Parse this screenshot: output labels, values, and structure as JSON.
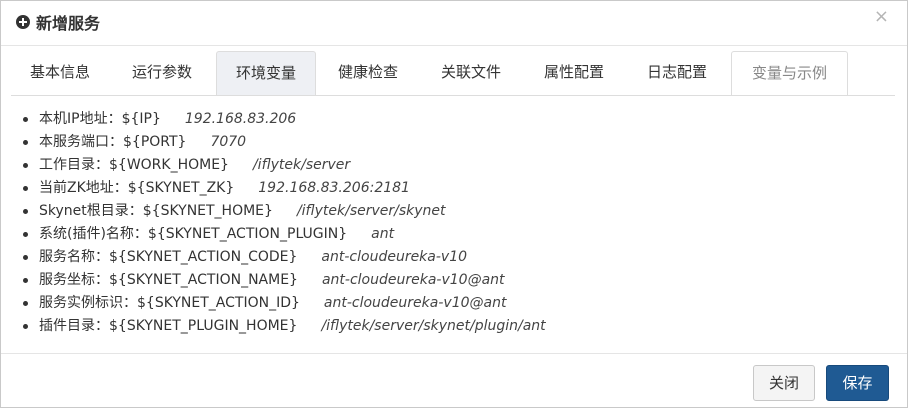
{
  "dialog": {
    "title": "新增服务",
    "close_glyph": "×"
  },
  "tabs": [
    {
      "label": "基本信息",
      "active": false
    },
    {
      "label": "运行参数",
      "active": false
    },
    {
      "label": "环境变量",
      "active": true
    },
    {
      "label": "健康检查",
      "active": false
    },
    {
      "label": "关联文件",
      "active": false
    },
    {
      "label": "属性配置",
      "active": false
    },
    {
      "label": "日志配置",
      "active": false
    },
    {
      "label": "变量与示例",
      "active": false
    }
  ],
  "variables": [
    {
      "label": "本机IP地址：${IP}",
      "value": "192.168.83.206"
    },
    {
      "label": "本服务端口：${PORT}",
      "value": "7070"
    },
    {
      "label": "工作目录：${WORK_HOME}",
      "value": "/iflytek/server"
    },
    {
      "label": "当前ZK地址：${SKYNET_ZK}",
      "value": "192.168.83.206:2181"
    },
    {
      "label": "Skynet根目录：${SKYNET_HOME}",
      "value": "/iflytek/server/skynet"
    },
    {
      "label": "系统(插件)名称：${SKYNET_ACTION_PLUGIN}",
      "value": "ant"
    },
    {
      "label": "服务名称：${SKYNET_ACTION_CODE}",
      "value": "ant-cloudeureka-v10"
    },
    {
      "label": "服务坐标：${SKYNET_ACTION_NAME}",
      "value": "ant-cloudeureka-v10@ant"
    },
    {
      "label": "服务实例标识：${SKYNET_ACTION_ID}",
      "value": "ant-cloudeureka-v10@ant"
    },
    {
      "label": "插件目录：${SKYNET_PLUGIN_HOME}",
      "value": "/iflytek/server/skynet/plugin/ant"
    }
  ],
  "footer": {
    "close_label": "关闭",
    "save_label": "保存"
  },
  "colors": {
    "primary": "#1f5a93",
    "active_tab_bg": "#eef0f4"
  },
  "icons": {
    "title_icon": "plus-circle-icon",
    "close_icon": "close-icon"
  }
}
